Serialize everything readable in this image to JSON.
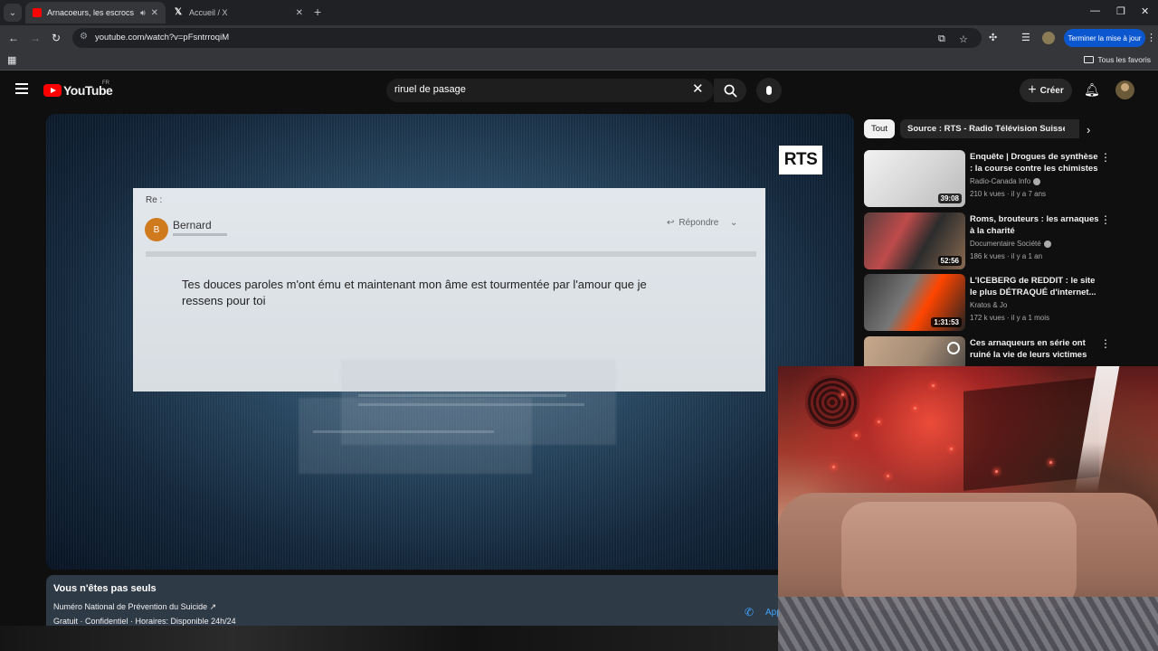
{
  "browser": {
    "tabs": [
      {
        "title": "Arnacoeurs, les escrocs de l",
        "active": true
      },
      {
        "title": "Accueil / X",
        "active": false
      }
    ],
    "url": "youtube.com/watch?v=pFsntrroqiM",
    "update_button": "Terminer la mise à jour",
    "bookmarks_folder": "Tous les favoris"
  },
  "youtube": {
    "logo_text": "YouTube",
    "country": "FR",
    "search_query": "riruel de pasage",
    "create_label": "Créer"
  },
  "video": {
    "channel_logo": "RTS",
    "email": {
      "subject": "Re :",
      "sender_initial": "B",
      "sender": "Bernard",
      "reply_label": "Répondre",
      "body": "Tes douces paroles m'ont ému et maintenant mon âme est tourmentée par l'amour que je ressens pour toi"
    }
  },
  "info_panel": {
    "title": "Vous n'êtes pas seuls",
    "line1": "Numéro National de Prévention du Suicide ↗",
    "line2": "Gratuit · Confidentiel · Horaires: Disponible 24h/24",
    "call_label": "App"
  },
  "chips": [
    {
      "label": "Tout",
      "active": true
    },
    {
      "label": "Source : RTS - Radio Télévision Suisse",
      "active": false
    }
  ],
  "recommendations": [
    {
      "title": "Enquête | Drogues de synthèse : la course contre les chimistes",
      "channel": "Radio-Canada Info",
      "verified": true,
      "meta": "210 k vues · il y a 7 ans",
      "duration": "39:08"
    },
    {
      "title": "Roms, brouteurs : les arnaques à la charité",
      "channel": "Documentaire Société",
      "verified": true,
      "meta": "186 k vues · il y a 1 an",
      "duration": "52:56"
    },
    {
      "title": "L'ICEBERG de REDDIT : le site le plus DÉTRAQUÉ d'internet...",
      "channel": "Kratos & Jo",
      "verified": false,
      "meta": "172 k vues · il y a 1 mois",
      "duration": "1:31:53"
    },
    {
      "title": "Ces arnaqueurs en série ont ruiné la vie de leurs victimes",
      "channel": "",
      "verified": false,
      "meta": "",
      "duration": ""
    }
  ]
}
